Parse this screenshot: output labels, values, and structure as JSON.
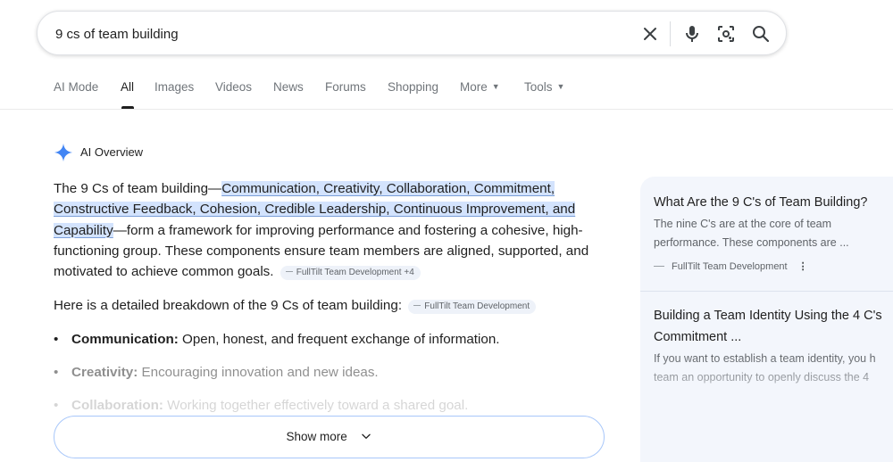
{
  "search": {
    "query": "9 cs of team building"
  },
  "tabs": [
    {
      "label": "AI Mode"
    },
    {
      "label": "All"
    },
    {
      "label": "Images"
    },
    {
      "label": "Videos"
    },
    {
      "label": "News"
    },
    {
      "label": "Forums"
    },
    {
      "label": "Shopping"
    },
    {
      "label": "More"
    },
    {
      "label": "Tools"
    }
  ],
  "ai_overview": {
    "header": "AI Overview",
    "intro_start": "The 9 Cs of team building—",
    "highlight_line1": "Communication, Creativity, Collaboration, Commitment,",
    "highlight_line2": "Constructive Feedback, Cohesion, Credible Leadership, Continuous Improvement, and",
    "highlight_line3": "Capability",
    "intro_rest_line3": "—form a framework for improving performance and fostering a cohesive, high-",
    "intro_line4": "functioning group. These components ensure team members are aligned, supported, and",
    "intro_line5": "motivated to achieve common goals.",
    "chip1": "FullTilt Team Development +4",
    "para2": "Here is a detailed breakdown of the 9 Cs of team building:",
    "chip2": "FullTilt Team Development",
    "bullets": [
      {
        "term": "Communication:",
        "desc": "Open, honest, and frequent exchange of information."
      },
      {
        "term": "Creativity:",
        "desc": "Encouraging innovation and new ideas."
      },
      {
        "term": "Collaboration:",
        "desc": "Working together effectively toward a shared goal."
      }
    ],
    "show_more": "Show more"
  },
  "side_cards": [
    {
      "title": "What Are the 9 C's of Team Building?",
      "snippet_line1": "The nine C's are at the core of team",
      "snippet_line2": "performance. These components are ...",
      "source": "FullTilt Team Development"
    },
    {
      "title_line1": "Building a Team Identity Using the 4 C's",
      "title_line2": "Commitment ...",
      "snippet_line1": "If you want to establish a team identity, you h",
      "snippet_line2": "team an opportunity to openly discuss the 4"
    }
  ],
  "colors": {
    "highlight": "#d3e3fd",
    "panel_bg": "#f3f6fc",
    "accent_blue": "#4285f4",
    "show_more_border": "#a8c7fa"
  }
}
